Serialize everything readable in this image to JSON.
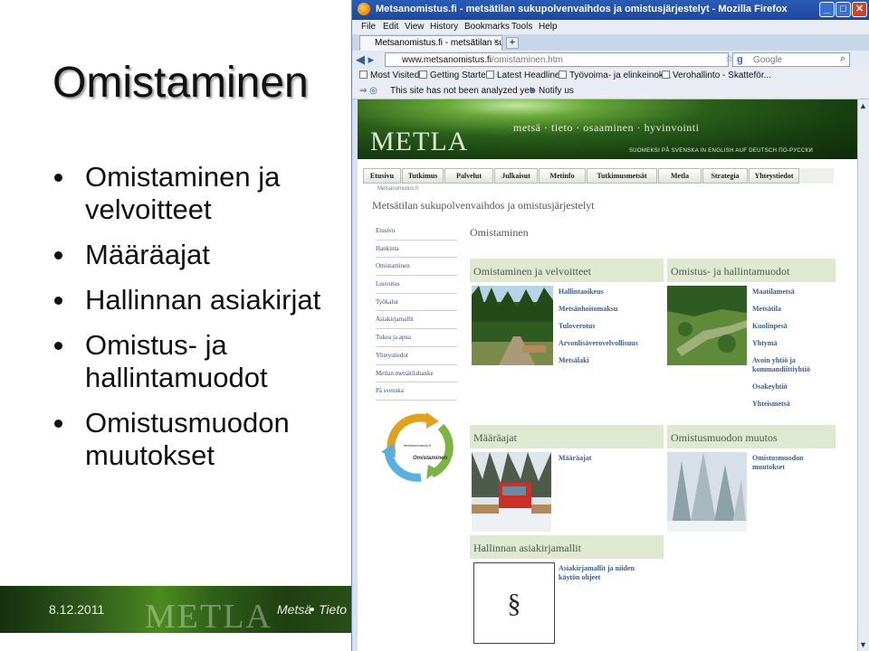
{
  "slide": {
    "title": "Omistaminen",
    "bullets": [
      "Omistaminen ja velvoitteet",
      "Määräajat",
      "Hallinnan asiakirjat",
      "Omistus- ja hallintamuodot",
      "Omistusmuodon muutokset"
    ],
    "footer": {
      "date": "8.12.2011",
      "logo": "METLA",
      "tag1": "Metsä",
      "tag2": "Tieto"
    }
  },
  "browser": {
    "window_title": "Metsanomistus.fi - metsätilan sukupolvenvaihdos ja omistusjärjestelyt - Mozilla Firefox",
    "menu": [
      "File",
      "Edit",
      "View",
      "History",
      "Bookmarks",
      "Tools",
      "Help"
    ],
    "tab_label": "Metsanomistus.fi - metsätilan suku...",
    "new_tab": "+",
    "url_host": "www.metsanomistus.fi",
    "url_path": "/omistaminen.htm",
    "search_placeholder": "Google",
    "bookmarks": [
      "Most Visited",
      "Getting Started",
      "Latest Headlines",
      "Työvoima- ja elinkeinok...",
      "Verohallinto - Skatteför..."
    ],
    "wot_status": "This site has not been analyzed yet",
    "notify": "Notify us"
  },
  "site": {
    "banner_logo": "METLA",
    "tagline": "metsä  ·  tieto  ·  osaaminen  ·  hyvinvointi",
    "langs": "SUOMEKSI   PÅ SVENSKA   IN ENGLISH   AUF DEUTSCH   ПО-РУССКИ",
    "nav": [
      "Etusivu",
      "Tutkimus",
      "Palvelut",
      "Julkaisut",
      "Metinfo",
      "Tutkimusmetsät",
      "Metla",
      "Strategia",
      "Yhteystiedot"
    ],
    "breadcrumb": "Metsanomistus.fi",
    "site_title": "Metsätilan sukupolvenvaihdos ja omistusjärjestelyt",
    "left_menu": [
      "Etusivu",
      "Hankinta",
      "Omistaminen",
      "Luovutus",
      "Työkalut",
      "Asiakirjamallit",
      "Tukea ja apua",
      "Yhteystiedot",
      "Metlan metsätilahanke",
      "På svenska"
    ],
    "cycle_labels": {
      "center": "Metsanomistus.fi",
      "main": "Omistaminen"
    },
    "page_heading": "Omistaminen",
    "sections": {
      "s1": {
        "title": "Omistaminen ja velvoitteet",
        "links": [
          "Hallintaoikeus",
          "Metsänhoitomaksu",
          "Tuloverotus",
          "Arvonlisäverovelvollisuus",
          "Metsälaki"
        ]
      },
      "s2": {
        "title": "Omistus- ja hallintamuodot",
        "links": [
          "Maatilametsä",
          "Metsätila",
          "Kuolinpesä",
          "Yhtymä",
          "Avoin yhtiö ja",
          "kommandiittiyhtiö",
          "Osakeyhtiö",
          "Yhteismetsä"
        ]
      },
      "s3": {
        "title": "Määräajat",
        "links": [
          "Määräajat"
        ]
      },
      "s4": {
        "title": "Omistusmuodon muutos",
        "links": [
          "Omistusmuodon",
          "muutokset"
        ]
      },
      "s5": {
        "title": "Hallinnan asiakirjamallit",
        "links": [
          "Asiakirjamallit ja niiden",
          "käytön ohjeet"
        ],
        "doc_symbol": "§"
      }
    }
  },
  "colors": {
    "accent": "#395c93",
    "section_bg": "#dfe8d0",
    "titlebar": "#2a5cb5"
  }
}
